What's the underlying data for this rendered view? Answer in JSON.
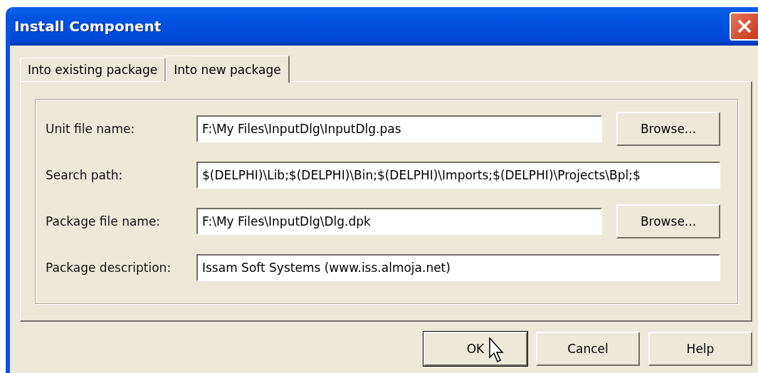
{
  "window": {
    "title": "Install Component"
  },
  "tabs": [
    {
      "label": "Into existing package",
      "selected": false
    },
    {
      "label": "Into new package",
      "selected": true
    }
  ],
  "fields": [
    {
      "label": "Unit file name:",
      "value": "F:\\My Files\\InputDlg\\InputDlg.pas",
      "button": "Browse..."
    },
    {
      "label": "Search path:",
      "value": "$(DELPHI)\\Lib;$(DELPHI)\\Bin;$(DELPHI)\\Imports;$(DELPHI)\\Projects\\Bpl;$"
    },
    {
      "label": "Package file name:",
      "value": "F:\\My Files\\InputDlg\\Dlg.dpk",
      "button": "Browse..."
    },
    {
      "label": "Package description:",
      "value": "Issam Soft Systems (www.iss.almoja.net)"
    }
  ],
  "buttons": [
    {
      "label": "OK",
      "default": true
    },
    {
      "label": "Cancel",
      "default": false
    },
    {
      "label": "Help",
      "default": false
    }
  ]
}
